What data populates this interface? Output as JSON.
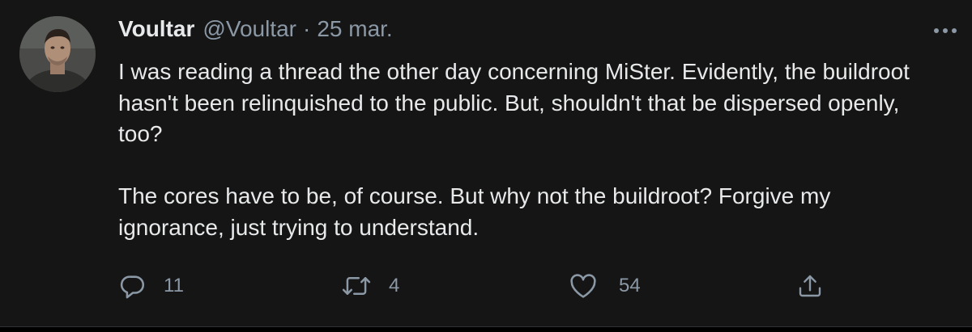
{
  "tweet": {
    "author": {
      "display_name": "Voultar",
      "handle": "@Voultar",
      "avatar_icon": "user-avatar"
    },
    "separator": "·",
    "date": "25 mar.",
    "paragraphs": [
      "I was reading a thread the other day concerning MiSter. Evidently, the buildroot hasn't been relinquished to the public. But, shouldn't that be dispersed openly, too?",
      "The cores have to be, of course. But why not the buildroot? Forgive my ignorance, just trying to understand."
    ],
    "actions": {
      "reply": {
        "icon": "reply-icon",
        "count": "11"
      },
      "retweet": {
        "icon": "retweet-icon",
        "count": "4"
      },
      "like": {
        "icon": "heart-icon",
        "count": "54"
      },
      "share": {
        "icon": "share-icon"
      }
    },
    "more_icon": "more-options-icon"
  },
  "colors": {
    "background": "#151515",
    "text": "#e7e9ea",
    "secondary_text": "#8b98a5"
  }
}
